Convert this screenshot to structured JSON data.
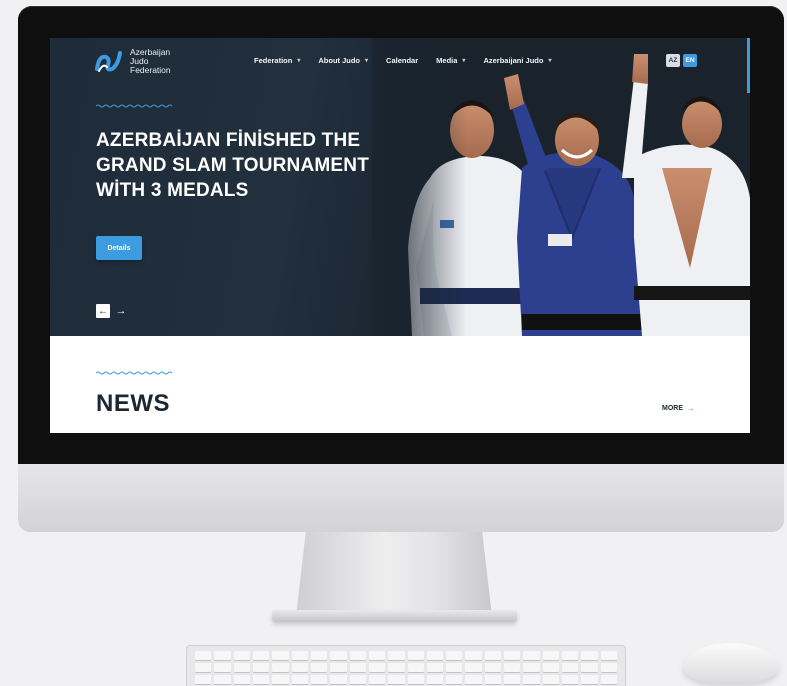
{
  "logo": {
    "line1": "Azerbaijan",
    "line2": "Judo",
    "line3": "Federation",
    "icon": "federation-logo-icon"
  },
  "nav": {
    "items": [
      {
        "label": "Federation",
        "has_dropdown": true
      },
      {
        "label": "About Judo",
        "has_dropdown": true
      },
      {
        "label": "Calendar",
        "has_dropdown": false
      },
      {
        "label": "Media",
        "has_dropdown": true
      },
      {
        "label": "Azerbaijani Judo",
        "has_dropdown": true
      }
    ],
    "caret": "▾"
  },
  "language": {
    "az": "AZ",
    "en": "EN",
    "active": "EN"
  },
  "hero": {
    "title": "AZERBAİJAN FİNİSHED THE GRAND SLAM TOURNAMENT WİTH 3 MEDALS",
    "details_label": "Details",
    "prev_arrow": "←",
    "next_arrow": "→"
  },
  "news": {
    "title": "NEWS",
    "more_label": "MORE",
    "more_arrow": "→"
  },
  "colors": {
    "accent": "#3d9be0",
    "hero_bg": "#1e2c3a",
    "dark_text": "#1c2733"
  }
}
